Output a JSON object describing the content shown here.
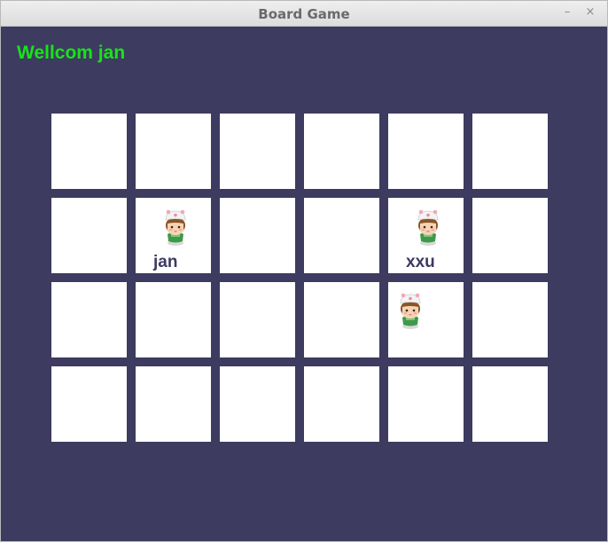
{
  "window": {
    "title": "Board Game",
    "minimize_glyph": "–",
    "close_glyph": "×"
  },
  "welcome_text": "Wellcom jan",
  "colors": {
    "background": "#3d3b60",
    "cell": "#ffffff",
    "welcome": "#18e418",
    "player_label": "#3d3b60"
  },
  "board": {
    "rows": 4,
    "cols": 6,
    "tokens": [
      {
        "row": 1,
        "col": 1,
        "icon": "player-avatar-icon",
        "label": "jan"
      },
      {
        "row": 1,
        "col": 4,
        "icon": "player-avatar-icon",
        "label": "xxu"
      },
      {
        "row": 2,
        "col": 4,
        "icon": "player-avatar-icon",
        "label": ""
      }
    ]
  }
}
